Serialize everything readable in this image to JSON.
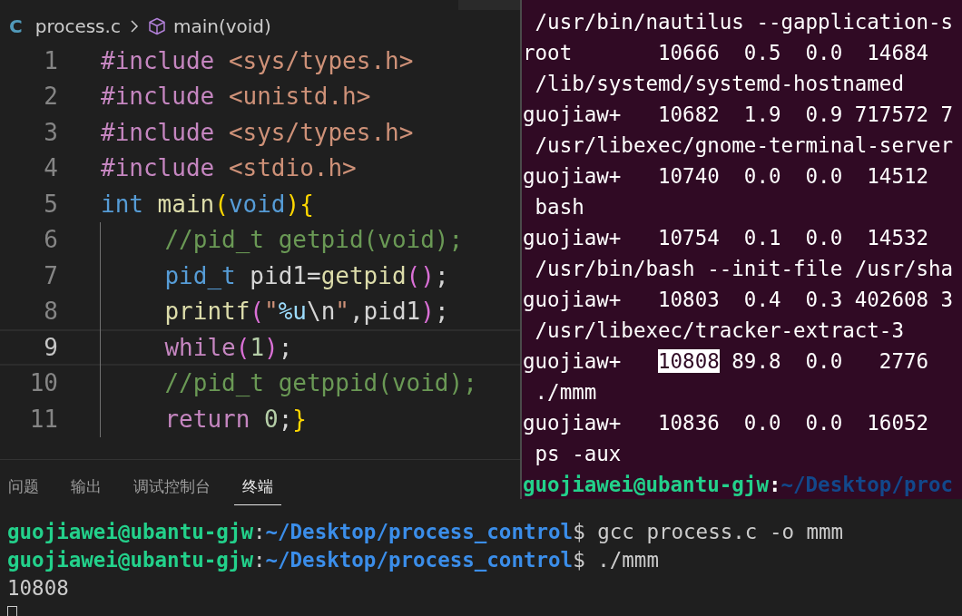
{
  "breadcrumb": {
    "file": "process.c",
    "file_icon": "C",
    "symbol": "main(void)"
  },
  "code_lines": [
    {
      "number": "1",
      "current": false,
      "indented": false,
      "tokens": [
        {
          "text": "#include",
          "kind": "keyword"
        },
        {
          "text": " <sys/types.h>",
          "kind": "string"
        }
      ]
    },
    {
      "number": "2",
      "current": false,
      "indented": false,
      "tokens": [
        {
          "text": "#include",
          "kind": "keyword"
        },
        {
          "text": " <unistd.h>",
          "kind": "string"
        }
      ]
    },
    {
      "number": "3",
      "current": false,
      "indented": false,
      "tokens": [
        {
          "text": "#include",
          "kind": "keyword"
        },
        {
          "text": " <sys/types.h>",
          "kind": "string"
        }
      ]
    },
    {
      "number": "4",
      "current": false,
      "indented": false,
      "tokens": [
        {
          "text": "#include",
          "kind": "keyword"
        },
        {
          "text": " <stdio.h>",
          "kind": "string"
        }
      ]
    },
    {
      "number": "5",
      "current": false,
      "indented": false,
      "tokens": [
        {
          "text": "int",
          "kind": "type"
        },
        {
          "text": " main",
          "kind": "function"
        },
        {
          "text": "(",
          "kind": "bracket1"
        },
        {
          "text": "void",
          "kind": "type"
        },
        {
          "text": ")",
          "kind": "bracket1"
        },
        {
          "text": "{",
          "kind": "bracket1"
        }
      ]
    },
    {
      "number": "6",
      "current": false,
      "indented": true,
      "tokens": [
        {
          "text": "//pid_t getpid(void);",
          "kind": "comment"
        }
      ]
    },
    {
      "number": "7",
      "current": false,
      "indented": true,
      "tokens": [
        {
          "text": "pid_t",
          "kind": "type"
        },
        {
          "text": " pid1=",
          "kind": "plain"
        },
        {
          "text": "getpid",
          "kind": "function"
        },
        {
          "text": "()",
          "kind": "bracket2"
        },
        {
          "text": ";",
          "kind": "plain"
        }
      ]
    },
    {
      "number": "8",
      "current": false,
      "indented": true,
      "tokens": [
        {
          "text": "printf",
          "kind": "function"
        },
        {
          "text": "(",
          "kind": "bracket2"
        },
        {
          "text": "\"",
          "kind": "string"
        },
        {
          "text": "%u",
          "kind": "format"
        },
        {
          "text": "\\n",
          "kind": "plain"
        },
        {
          "text": "\"",
          "kind": "string"
        },
        {
          "text": ",pid1",
          "kind": "plain"
        },
        {
          "text": ")",
          "kind": "bracket2"
        },
        {
          "text": ";",
          "kind": "plain"
        }
      ]
    },
    {
      "number": "9",
      "current": true,
      "indented": true,
      "tokens": [
        {
          "text": "while",
          "kind": "keyword"
        },
        {
          "text": "(",
          "kind": "bracket2"
        },
        {
          "text": "1",
          "kind": "number"
        },
        {
          "text": ")",
          "kind": "bracket2"
        },
        {
          "text": ";",
          "kind": "plain"
        }
      ]
    },
    {
      "number": "10",
      "current": false,
      "indented": true,
      "tokens": [
        {
          "text": "//pid_t getppid(void);",
          "kind": "comment"
        }
      ]
    },
    {
      "number": "11",
      "current": false,
      "indented": true,
      "tokens": [
        {
          "text": "return",
          "kind": "keyword"
        },
        {
          "text": " 0",
          "kind": "number"
        },
        {
          "text": ";",
          "kind": "plain"
        },
        {
          "text": "}",
          "kind": "bracket1"
        }
      ]
    }
  ],
  "panel_tabs": [
    {
      "label": "问题",
      "selected": false
    },
    {
      "label": "输出",
      "selected": false
    },
    {
      "label": "调试控制台",
      "selected": false
    },
    {
      "label": "终端",
      "selected": true
    }
  ],
  "panel_terminal": {
    "lines": [
      {
        "kind": "prompt",
        "user": "guojiawei@ubantu-gjw",
        "separator": ":",
        "path": "~/Desktop/process_control",
        "command": "$ gcc process.c -o mmm"
      },
      {
        "kind": "prompt",
        "user": "guojiawei@ubantu-gjw",
        "separator": ":",
        "path": "~/Desktop/process_control",
        "command": "$ ./mmm"
      },
      {
        "kind": "output",
        "text": "10808"
      }
    ]
  },
  "terminal_window": {
    "lines": [
      {
        "segments": [
          {
            "text": " /usr/bin/nautilus --gapplication-s",
            "selected": false
          }
        ]
      },
      {
        "segments": [
          {
            "text": "root       10666  0.5  0.0  14684",
            "selected": false
          }
        ]
      },
      {
        "segments": [
          {
            "text": " /lib/systemd/systemd-hostnamed",
            "selected": false
          }
        ]
      },
      {
        "segments": [
          {
            "text": "guojiaw+   10682  1.9  0.9 717572 7",
            "selected": false
          }
        ]
      },
      {
        "segments": [
          {
            "text": " /usr/libexec/gnome-terminal-server",
            "selected": false
          }
        ]
      },
      {
        "segments": [
          {
            "text": "guojiaw+   10740  0.0  0.0  14512",
            "selected": false
          }
        ]
      },
      {
        "segments": [
          {
            "text": " bash",
            "selected": false
          }
        ]
      },
      {
        "segments": [
          {
            "text": "guojiaw+   10754  0.1  0.0  14532",
            "selected": false
          }
        ]
      },
      {
        "segments": [
          {
            "text": " /usr/bin/bash --init-file /usr/sha",
            "selected": false
          }
        ]
      },
      {
        "segments": [
          {
            "text": "guojiaw+   10803  0.4  0.3 402608 3",
            "selected": false
          }
        ]
      },
      {
        "segments": [
          {
            "text": " /usr/libexec/tracker-extract-3",
            "selected": false
          }
        ]
      },
      {
        "segments": [
          {
            "text": "guojiaw+   ",
            "selected": false
          },
          {
            "text": "10808",
            "selected": true
          },
          {
            "text": " 89.8  0.0   2776",
            "selected": false
          }
        ]
      },
      {
        "segments": [
          {
            "text": " ./mmm",
            "selected": false
          }
        ]
      },
      {
        "segments": [
          {
            "text": "guojiaw+   10836  0.0  0.0  16052",
            "selected": false
          }
        ]
      },
      {
        "segments": [
          {
            "text": " ps -aux",
            "selected": false
          }
        ]
      }
    ],
    "prompt": {
      "user": "guojiawei@ubantu-gjw",
      "separator": ":",
      "path": "~/Desktop/proc"
    }
  }
}
